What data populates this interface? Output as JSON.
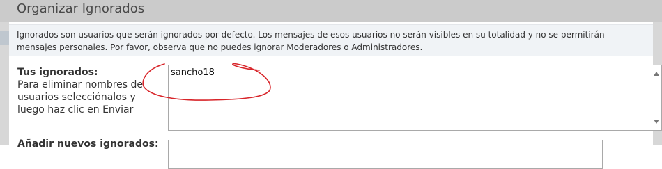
{
  "header": {
    "title": "Organizar Ignorados"
  },
  "notice": {
    "text": "Ignorados son usuarios que serán ignorados por defecto. Los mensajes de esos usuarios no serán visibles en su totalidad y no se permitirán mensajes personales. Por favor, observa que no puedes ignorar Moderadores o Administradores."
  },
  "ignored": {
    "label": "Tus ignorados:",
    "description": "Para eliminar nombres de usuarios selecciónalos y luego haz clic en Enviar",
    "entries": [
      "sancho18"
    ]
  },
  "add_ignored": {
    "label": "Añadir nuevos ignorados:"
  },
  "annotation": {
    "color": "#d8252a"
  }
}
